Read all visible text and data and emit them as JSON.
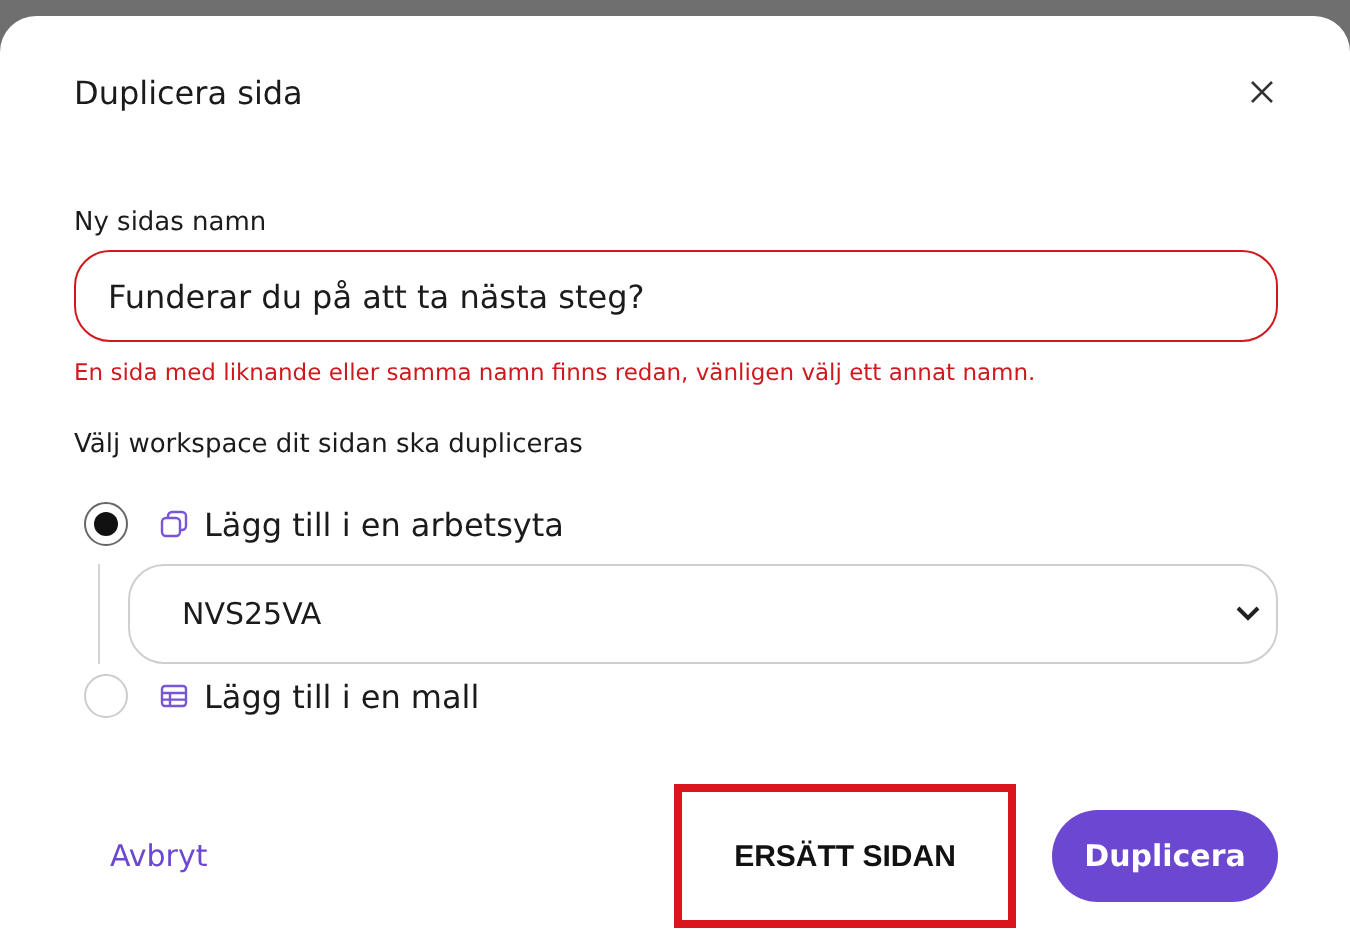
{
  "dialog": {
    "title": "Duplicera sida"
  },
  "name_field": {
    "label": "Ny sidas namn",
    "value": "Funderar du på att ta nästa steg?",
    "invalid": true,
    "error": "En sida med liknande eller samma namn finns redan, vänligen välj ett annat namn."
  },
  "destination": {
    "label": "Välj workspace dit sidan ska dupliceras",
    "options": [
      {
        "label": "Lägg till i en arbetsyta",
        "selected": true,
        "kind": "workspace"
      },
      {
        "label": "Lägg till i en mall",
        "selected": false,
        "kind": "template"
      }
    ],
    "select": {
      "value": "NVS25VA"
    }
  },
  "buttons": [
    {
      "label": "Avbryt",
      "kind": "text"
    },
    {
      "label": "ERSÄTT SIDAN",
      "kind": "outlined"
    },
    {
      "label": "Duplicera",
      "kind": "primary"
    }
  ]
}
